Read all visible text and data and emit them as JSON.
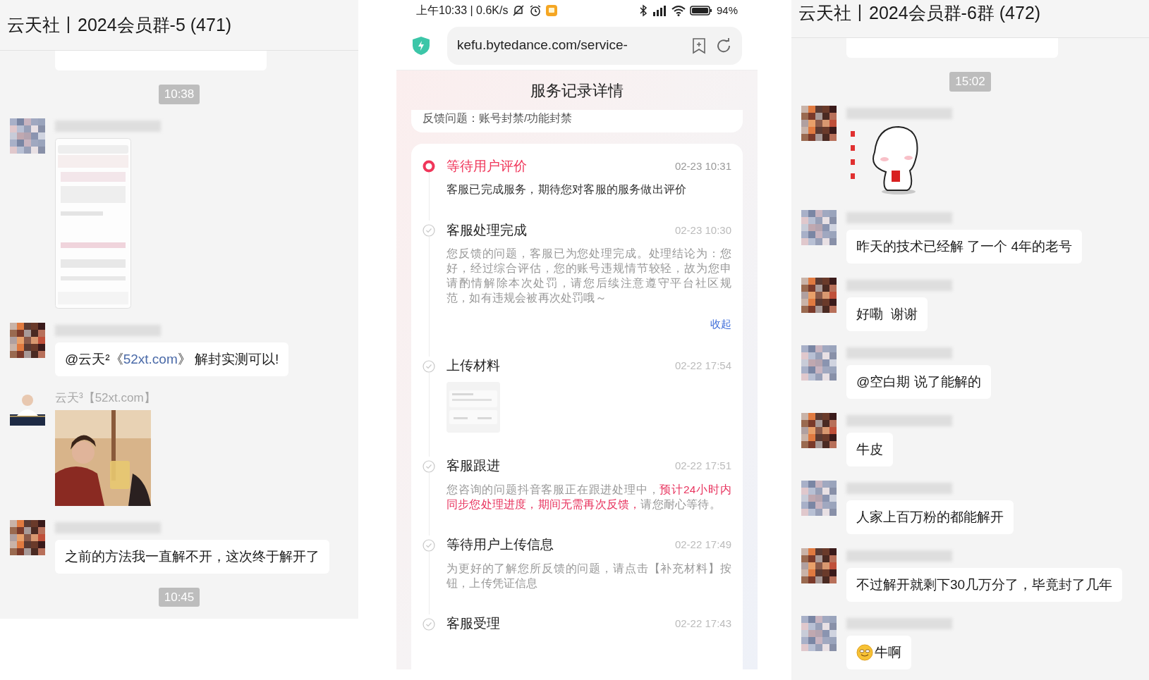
{
  "left_chat": {
    "title": "云天社丨2024会员群-5 (471)",
    "items": [
      {
        "kind": "time",
        "text": "10:38"
      },
      {
        "kind": "screenshot"
      },
      {
        "kind": "text",
        "segments": [
          {
            "text": "@云天²《",
            "link": false
          },
          {
            "text": "52xt.com",
            "link": true
          },
          {
            "text": "》 解封实测可以!",
            "link": false
          }
        ]
      },
      {
        "name": "云天³【52xt.com】"
      },
      {
        "kind": "text",
        "segments": [
          {
            "text": "之前的方法我一直解不开，这次终于解开了",
            "link": false
          }
        ]
      },
      {
        "kind": "time",
        "text": "10:45"
      }
    ]
  },
  "browser": {
    "status_time": "上午10:33 | 0.6K/s",
    "battery": "94%",
    "url": "kefu.bytedance.com/service-",
    "page_title": "服务记录详情",
    "feedback": "反馈问题：账号封禁/功能封禁",
    "events": [
      {
        "kind": "current",
        "title": "等待用户评价",
        "time": "02-23 10:31",
        "description": [
          {
            "text": "客服已完成服务，期待您对客服的服务做出评价",
            "highlight": false
          }
        ]
      },
      {
        "kind": "done",
        "title": "客服处理完成",
        "time": "02-23 10:30",
        "description": [
          {
            "text": "您反馈的问题，客服已为您处理完成。处理结论为：您好，经过综合评估，您的账号违规情节较轻，故为您申请酌情解除本次处罚，请您后续注意遵守平台社区规范，如有违规会被再次处罚哦～",
            "highlight": false
          }
        ],
        "action": "收起"
      },
      {
        "kind": "done",
        "title": "上传材料",
        "time": "02-22 17:54"
      },
      {
        "kind": "done",
        "title": "客服跟进",
        "time": "02-22 17:51",
        "description": [
          {
            "text": "您咨询的问题抖音客服正在跟进处理中，",
            "highlight": false
          },
          {
            "text": "预计24小时内同步您处理进度，期间无需再次反馈，",
            "highlight": true
          },
          {
            "text": "请您耐心等待。",
            "highlight": false
          }
        ]
      },
      {
        "kind": "done",
        "title": "等待用户上传信息",
        "time": "02-22 17:49",
        "description": [
          {
            "text": "为更好的了解您所反馈的问题，请点击【补充材料】按钮，上传凭证信息",
            "highlight": false
          }
        ]
      },
      {
        "kind": "done",
        "title": "客服受理",
        "time": "02-22 17:43"
      }
    ]
  },
  "right_chat": {
    "title": "云天社丨2024会员群-6群 (472)",
    "items": [
      {
        "kind": "time",
        "text": "15:02"
      },
      {
        "kind": "sticker"
      },
      {
        "kind": "text",
        "segments": [
          {
            "text": "昨天的技术已经解 了一个 4年的老号",
            "link": false
          }
        ]
      },
      {
        "kind": "text",
        "segments": [
          {
            "text": "好嘞  谢谢",
            "link": false
          }
        ]
      },
      {
        "kind": "text",
        "segments": [
          {
            "text": "@空白期 说了能解的",
            "link": false
          }
        ]
      },
      {
        "kind": "text",
        "segments": [
          {
            "text": "牛皮",
            "link": false
          }
        ]
      },
      {
        "kind": "text",
        "segments": [
          {
            "text": "人家上百万粉的都能解开",
            "link": false
          }
        ]
      },
      {
        "kind": "text",
        "segments": [
          {
            "text": "不过解开就剩下30几万分了，毕竟封了几年",
            "link": false
          }
        ]
      },
      {
        "kind": "text",
        "emoji": true,
        "segments": [
          {
            "text": "牛啊",
            "link": false
          }
        ]
      }
    ]
  }
}
